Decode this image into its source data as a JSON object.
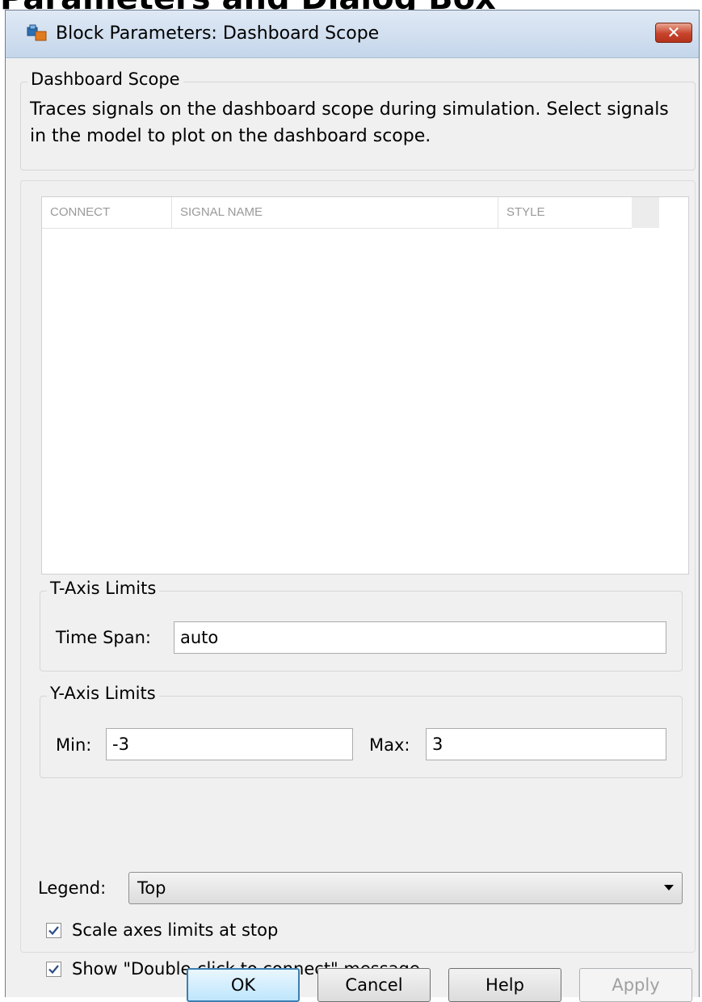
{
  "doc_heading": "Parameters and Dialog Box",
  "window": {
    "title": "Block Parameters: Dashboard Scope",
    "close_label": "✕"
  },
  "description": {
    "group_title": "Dashboard Scope",
    "text": "Traces signals on the dashboard scope during simulation. Select signals in the model to plot on the dashboard scope."
  },
  "signal_table": {
    "columns": [
      "CONNECT",
      "SIGNAL NAME",
      "STYLE"
    ],
    "rows": []
  },
  "t_axis": {
    "group_title": "T-Axis Limits",
    "time_span_label": "Time Span:",
    "time_span_value": "auto"
  },
  "y_axis": {
    "group_title": "Y-Axis Limits",
    "min_label": "Min:",
    "min_value": "-3",
    "max_label": "Max:",
    "max_value": "3"
  },
  "legend": {
    "label": "Legend:",
    "selected": "Top"
  },
  "options": {
    "scale_axes": {
      "label": "Scale axes limits at stop",
      "checked": true
    },
    "show_message": {
      "label": "Show \"Double-click to connect\" message",
      "checked": true
    }
  },
  "buttons": {
    "ok": "OK",
    "cancel": "Cancel",
    "help": "Help",
    "apply": "Apply"
  },
  "colors": {
    "dialog_bg": "#f0f0f0",
    "close_red": "#c8432b",
    "default_button_border": "#3c7fb1"
  }
}
